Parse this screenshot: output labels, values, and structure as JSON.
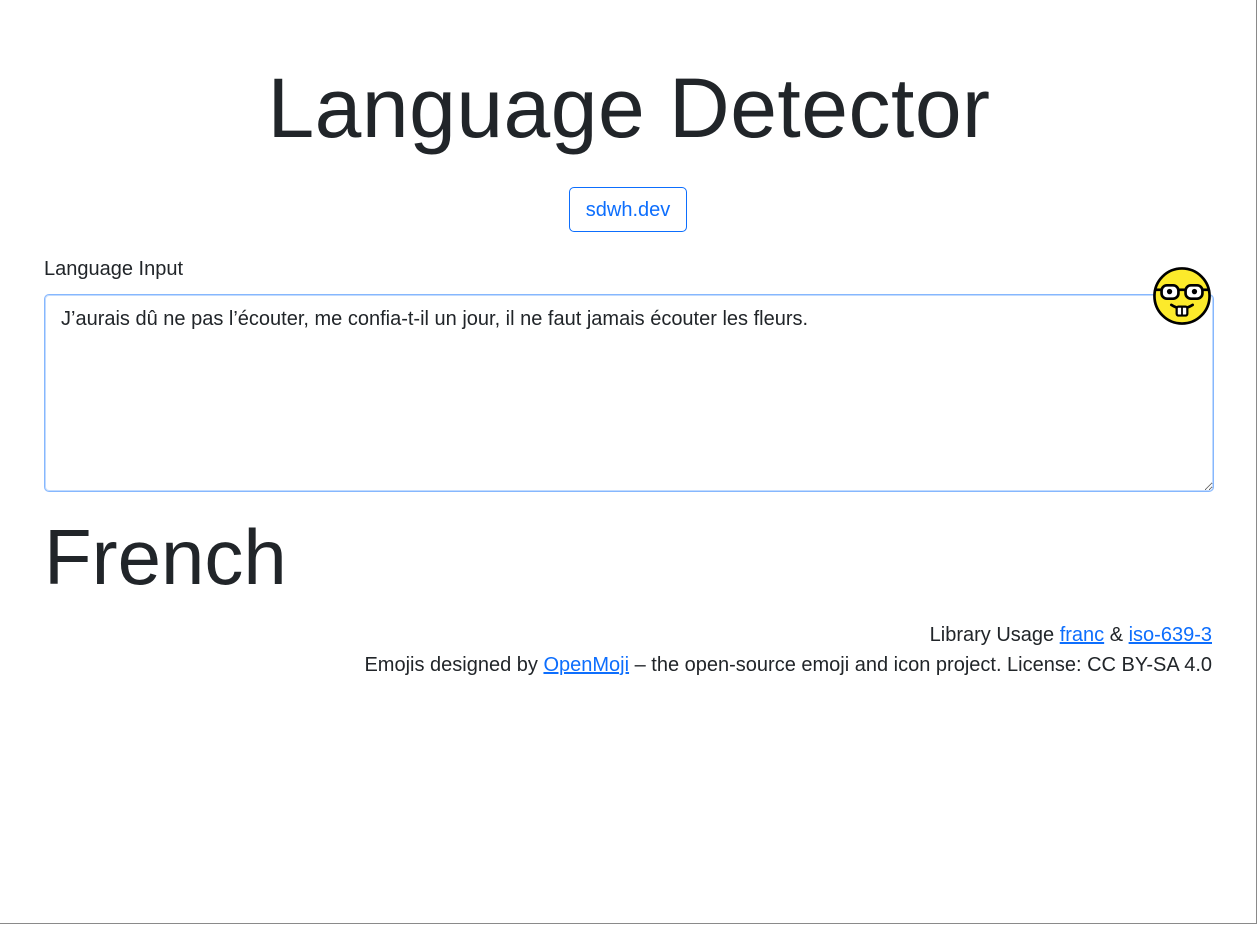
{
  "header": {
    "title": "Language Detector",
    "site_button_label": "sdwh.dev"
  },
  "input": {
    "label": "Language Input",
    "value": "J’aurais dû ne pas l’écouter, me confia-t-il un jour, il ne faut jamais écouter les fleurs."
  },
  "result": {
    "language": "French"
  },
  "footer": {
    "library_prefix": "Library Usage ",
    "library_link_1": "franc",
    "library_sep": " & ",
    "library_link_2": "iso-639-3",
    "emoji_prefix": "Emojis designed by ",
    "emoji_link": "OpenMoji",
    "emoji_suffix": " – the open-source emoji and icon project. License: CC BY-SA 4.0"
  },
  "icons": {
    "emoji": "nerd-face-icon"
  },
  "colors": {
    "accent": "#0d6efd",
    "text": "#212529",
    "emoji_yellow": "#FCEA2B"
  }
}
